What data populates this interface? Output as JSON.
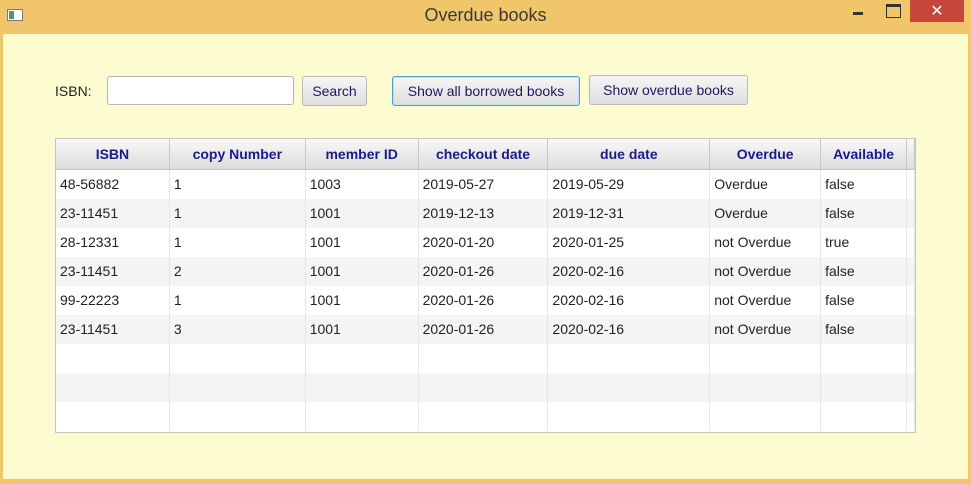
{
  "window": {
    "title": "Overdue books"
  },
  "search": {
    "label": "ISBN:",
    "value": "",
    "placeholder": "",
    "button_label": "Search"
  },
  "actions": {
    "show_all_label": "Show all borrowed books",
    "show_overdue_label": "Show overdue books"
  },
  "table": {
    "columns": [
      "ISBN",
      "copy Number",
      "member ID",
      "checkout date",
      "due date",
      "Overdue",
      "Available"
    ],
    "rows": [
      [
        "48-56882",
        "1",
        "1003",
        "2019-05-27",
        "2019-05-29",
        "Overdue",
        "false"
      ],
      [
        "23-11451",
        "1",
        "1001",
        "2019-12-13",
        "2019-12-31",
        "Overdue",
        "false"
      ],
      [
        "28-12331",
        "1",
        "1001",
        "2020-01-20",
        "2020-01-25",
        "not Overdue",
        "true"
      ],
      [
        "23-11451",
        "2",
        "1001",
        "2020-01-26",
        "2020-02-16",
        "not Overdue",
        "false"
      ],
      [
        "99-22223",
        "1",
        "1001",
        "2020-01-26",
        "2020-02-16",
        "not Overdue",
        "false"
      ],
      [
        "23-11451",
        "3",
        "1001",
        "2020-01-26",
        "2020-02-16",
        "not Overdue",
        "false"
      ]
    ]
  },
  "colors": {
    "titlebar": "#f1c56a",
    "client_bg": "#fdfbd0",
    "header_text": "#1a1a8a",
    "close_button": "#c7463a"
  }
}
